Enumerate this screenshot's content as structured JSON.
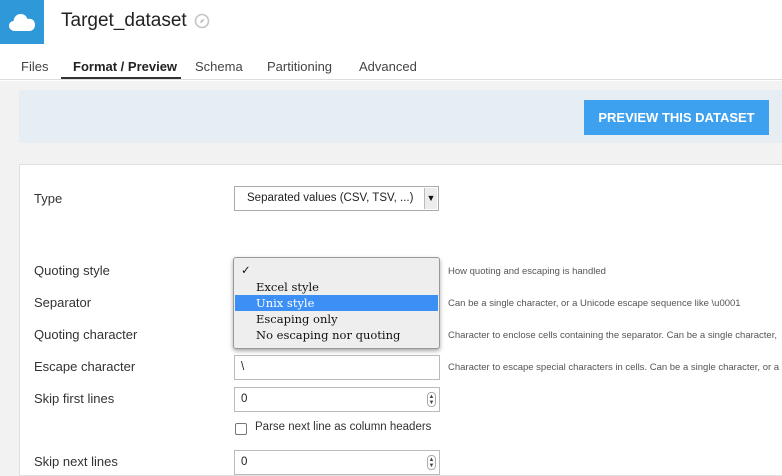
{
  "header": {
    "title": "Target_dataset"
  },
  "tabs": [
    {
      "label": "Files",
      "active": false
    },
    {
      "label": "Format / Preview",
      "active": true
    },
    {
      "label": "Schema",
      "active": false
    },
    {
      "label": "Partitioning",
      "active": false
    },
    {
      "label": "Advanced",
      "active": false
    }
  ],
  "preview": {
    "button_label": "PREVIEW THIS DATASET"
  },
  "form": {
    "type": {
      "label": "Type",
      "value": "Separated values (CSV, TSV, ...)"
    },
    "quoting_style": {
      "label": "Quoting style",
      "help": "How quoting and escaping is handled"
    },
    "separator": {
      "label": "Separator",
      "help": "Can be a single character, or a Unicode escape sequence like \\u0001"
    },
    "quoting_character": {
      "label": "Quoting character",
      "help": "Character to enclose cells containing the separator. Can be a single character,"
    },
    "escape_character": {
      "label": "Escape character",
      "value": "\\",
      "help": "Character to escape special characters in cells. Can be a single character, or a U"
    },
    "skip_first_lines": {
      "label": "Skip first lines",
      "value": "0"
    },
    "parse_header": {
      "label": "Parse next line as column headers",
      "checked": false
    },
    "skip_next_lines": {
      "label": "Skip next lines",
      "value": "0"
    }
  },
  "dropdown": {
    "check_glyph": "✓",
    "options": [
      {
        "label": "",
        "checked": true,
        "highlighted": false
      },
      {
        "label": "Excel style",
        "checked": false,
        "highlighted": false
      },
      {
        "label": "Unix style",
        "checked": false,
        "highlighted": true
      },
      {
        "label": "Escaping only",
        "checked": false,
        "highlighted": false
      },
      {
        "label": "No escaping nor quoting",
        "checked": false,
        "highlighted": false
      }
    ]
  },
  "colors": {
    "accent": "#3ea1f0",
    "brand_tile": "#2f98d8",
    "highlight": "#3b8ff5",
    "preview_band": "#e6eef3"
  }
}
